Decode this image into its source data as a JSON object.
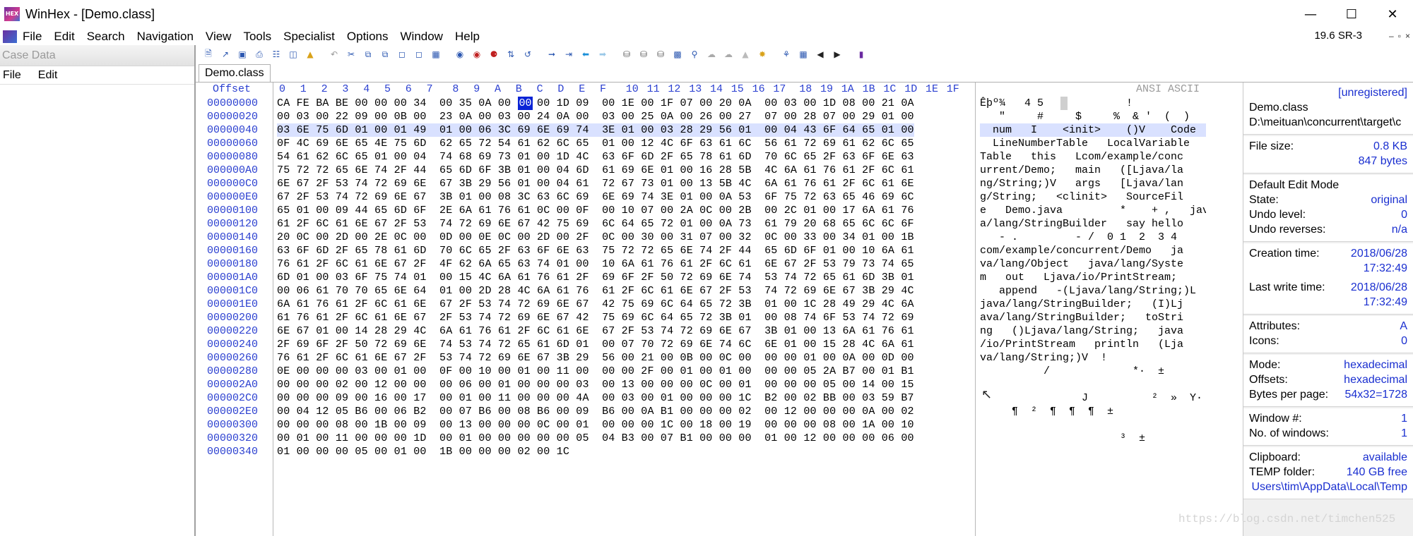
{
  "window": {
    "title": "WinHex - [Demo.class]",
    "logo_text": "HEX",
    "minimize": "—",
    "maximize": "☐",
    "close": "✕"
  },
  "menu": {
    "items": [
      "File",
      "Edit",
      "Search",
      "Navigation",
      "View",
      "Tools",
      "Specialist",
      "Options",
      "Window",
      "Help"
    ],
    "version": "19.6 SR-3",
    "mdi": [
      "–",
      "▫",
      "×"
    ]
  },
  "casedata": {
    "title": "Case Data",
    "menu": [
      "File",
      "Edit"
    ]
  },
  "tab": {
    "label": "Demo.class"
  },
  "hex": {
    "offset_header": "Offset",
    "columns": [
      "0",
      "1",
      "2",
      "3",
      "4",
      "5",
      "6",
      "7",
      "8",
      "9",
      "A",
      "B",
      "C",
      "D",
      "E",
      "F",
      "10",
      "11",
      "12",
      "13",
      "14",
      "15",
      "16",
      "17",
      "18",
      "19",
      "1A",
      "1B",
      "1C",
      "1D",
      "1E",
      "1F"
    ],
    "ascii_header": "ANSI ASCII",
    "cursor_byte": "00",
    "offsets": [
      "00000000",
      "00000020",
      "00000040",
      "00000060",
      "00000080",
      "000000A0",
      "000000C0",
      "000000E0",
      "00000100",
      "00000120",
      "00000140",
      "00000160",
      "00000180",
      "000001A0",
      "000001C0",
      "000001E0",
      "00000200",
      "00000220",
      "00000240",
      "00000260",
      "00000280",
      "000002A0",
      "000002C0",
      "000002E0",
      "00000300",
      "00000320",
      "00000340"
    ],
    "rows": [
      "CA FE BA BE 00 00 00 34  00 35 0A 00 0C 00 1D 09  00 1E 00 1F 07 00 20 0A  00 03 00 1D 08 00 21 0A",
      "00 03 00 22 09 00 0B 00  23 0A 00 03 00 24 0A 00  03 00 25 0A 00 26 00 27  07 00 28 07 00 29 01 00",
      "03 6E 75 6D 01 00 01 49  01 00 06 3C 69 6E 69 74  3E 01 00 03 28 29 56 01  00 04 43 6F 64 65 01 00",
      "0F 4C 69 6E 65 4E 75 6D  62 65 72 54 61 62 6C 65  01 00 12 4C 6F 63 61 6C  56 61 72 69 61 62 6C 65",
      "54 61 62 6C 65 01 00 04  74 68 69 73 01 00 1D 4C  63 6F 6D 2F 65 78 61 6D  70 6C 65 2F 63 6F 6E 63",
      "75 72 72 65 6E 74 2F 44  65 6D 6F 3B 01 00 04 6D  61 69 6E 01 00 16 28 5B  4C 6A 61 76 61 2F 6C 61",
      "6E 67 2F 53 74 72 69 6E  67 3B 29 56 01 00 04 61  72 67 73 01 00 13 5B 4C  6A 61 76 61 2F 6C 61 6E",
      "67 2F 53 74 72 69 6E 67  3B 01 00 08 3C 63 6C 69  6E 69 74 3E 01 00 0A 53  6F 75 72 63 65 46 69 6C",
      "65 01 00 09 44 65 6D 6F  2E 6A 61 76 61 0C 00 0F  00 10 07 00 2A 0C 00 2B  00 2C 01 00 17 6A 61 76",
      "61 2F 6C 61 6E 67 2F 53  74 72 69 6E 67 42 75 69  6C 64 65 72 01 00 0A 73  61 79 20 68 65 6C 6C 6F",
      "20 0C 00 2D 00 2E 0C 00  0D 00 0E 0C 00 2D 00 2F  0C 00 30 00 31 07 00 32  0C 00 33 00 34 01 00 1B",
      "63 6F 6D 2F 65 78 61 6D  70 6C 65 2F 63 6F 6E 63  75 72 72 65 6E 74 2F 44  65 6D 6F 01 00 10 6A 61",
      "76 61 2F 6C 61 6E 67 2F  4F 62 6A 65 63 74 01 00  10 6A 61 76 61 2F 6C 61  6E 67 2F 53 79 73 74 65",
      "6D 01 00 03 6F 75 74 01  00 15 4C 6A 61 76 61 2F  69 6F 2F 50 72 69 6E 74  53 74 72 65 61 6D 3B 01",
      "00 06 61 70 70 65 6E 64  01 00 2D 28 4C 6A 61 76  61 2F 6C 61 6E 67 2F 53  74 72 69 6E 67 3B 29 4C",
      "6A 61 76 61 2F 6C 61 6E  67 2F 53 74 72 69 6E 67  42 75 69 6C 64 65 72 3B  01 00 1C 28 49 29 4C 6A",
      "61 76 61 2F 6C 61 6E 67  2F 53 74 72 69 6E 67 42  75 69 6C 64 65 72 3B 01  00 08 74 6F 53 74 72 69",
      "6E 67 01 00 14 28 29 4C  6A 61 76 61 2F 6C 61 6E  67 2F 53 74 72 69 6E 67  3B 01 00 13 6A 61 76 61",
      "2F 69 6F 2F 50 72 69 6E  74 53 74 72 65 61 6D 01  00 07 70 72 69 6E 74 6C  6E 01 00 15 28 4C 6A 61",
      "76 61 2F 6C 61 6E 67 2F  53 74 72 69 6E 67 3B 29  56 00 21 00 0B 00 0C 00  00 00 01 00 0A 00 0D 00",
      "0E 00 00 00 03 00 01 00  0F 00 10 00 01 00 11 00  00 00 2F 00 01 00 01 00  00 00 05 2A B7 00 01 B1",
      "00 00 00 02 00 12 00 00  00 06 00 01 00 00 00 03  00 13 00 00 00 0C 00 01  00 00 00 05 00 14 00 15",
      "00 00 00 09 00 16 00 17  00 01 00 11 00 00 00 4A  00 03 00 01 00 00 00 1C  B2 00 02 BB 00 03 59 B7",
      "00 04 12 05 B6 00 06 B2  00 07 B6 00 08 B6 00 09  B6 00 0A B1 00 00 00 02  00 12 00 00 00 0A 00 02",
      "00 00 00 08 00 1B 00 09  00 13 00 00 00 0C 00 01  00 00 00 1C 00 18 00 19  00 00 00 08 00 1A 00 10",
      "00 01 00 11 00 00 00 1D  00 01 00 00 00 00 00 05  04 B3 00 07 B1 00 00 00  01 00 12 00 00 00 06 00",
      "01 00 00 00 05 00 01 00  1B 00 00 00 02 00 1C"
    ],
    "ascii": [
      "Êþº¾   4 5             !   ",
      "   \"     #     $     %  & '  (  )  ",
      "  num   I    <init>    ()V    Code  ",
      "  LineNumberTable   LocalVariable",
      "Table   this   Lcom/example/conc",
      "urrent/Demo;   main   ([Ljava/la",
      "ng/String;)V   args   [Ljava/lan",
      "g/String;   <clinit>   SourceFil",
      "e   Demo.java         *    + ,   jav",
      "a/lang/StringBuilder   say hello",
      "   - .         - /  0 1  2  3 4   ",
      "com/example/concurrent/Demo   ja",
      "va/lang/Object   java/lang/Syste",
      "m   out   Ljava/io/PrintStream;",
      "   append   -(Ljava/lang/String;)L",
      "java/lang/StringBuilder;   (I)Lj",
      "ava/lang/StringBuilder;   toStri",
      "ng   ()Ljava/lang/String;   java",
      "/io/PrintStream   println   (Lja",
      "va/lang/String;)V  !              ",
      "          /             *·  ±",
      "                                  ",
      "                J          ²  »  Y·",
      "     ¶  ²  ¶  ¶  ¶  ±           ",
      "                                  ",
      "                      ³  ±         ",
      "                                  "
    ]
  },
  "info": {
    "registration": "[unregistered]",
    "filename": "Demo.class",
    "path": "D:\\meituan\\concurrent\\target\\c",
    "file_size_label": "File size:",
    "file_size_kb": "0.8 KB",
    "file_size_bytes": "847 bytes",
    "edit_mode": "Default Edit Mode",
    "state_label": "State:",
    "state_val": "original",
    "undo_level_label": "Undo level:",
    "undo_level_val": "0",
    "undo_rev_label": "Undo reverses:",
    "undo_rev_val": "n/a",
    "creation_label": "Creation time:",
    "creation_date": "2018/06/28",
    "creation_time": "17:32:49",
    "lastwrite_label": "Last write time:",
    "lastwrite_date": "2018/06/28",
    "lastwrite_time": "17:32:49",
    "attributes_label": "Attributes:",
    "attributes_val": "A",
    "icons_label": "Icons:",
    "icons_val": "0",
    "mode_label": "Mode:",
    "mode_val": "hexadecimal",
    "offsets_label": "Offsets:",
    "offsets_val": "hexadecimal",
    "bpp_label": "Bytes per page:",
    "bpp_val": "54x32=1728",
    "window_num_label": "Window #:",
    "window_num_val": "1",
    "num_windows_label": "No. of windows:",
    "num_windows_val": "1",
    "clipboard_label": "Clipboard:",
    "clipboard_val": "available",
    "temp_label": "TEMP folder:",
    "temp_val": "140 GB free",
    "temp_path": "Users\\tim\\AppData\\Local\\Temp"
  },
  "watermark": "https://blog.csdn.net/timchen525"
}
